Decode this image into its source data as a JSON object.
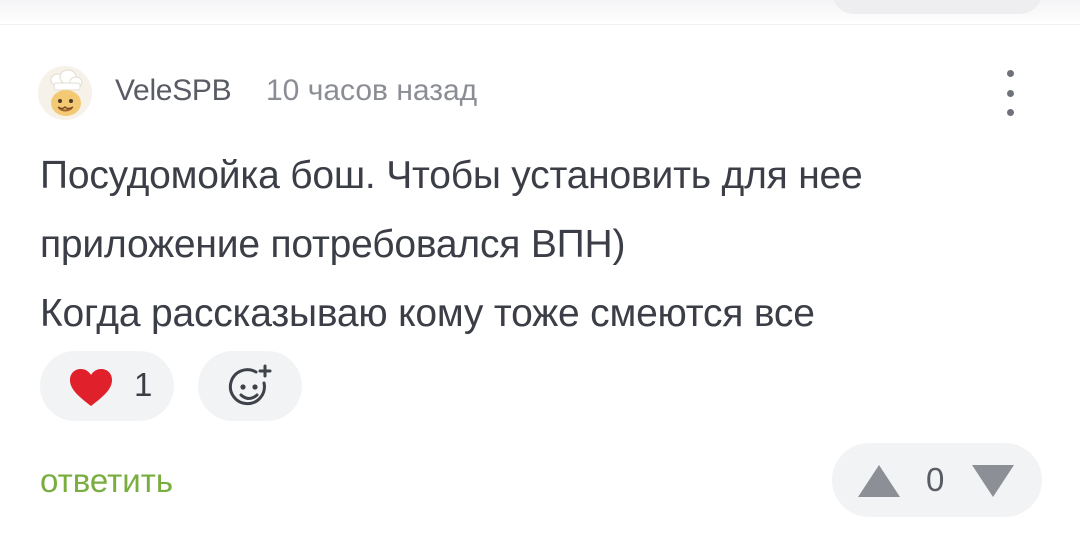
{
  "comment": {
    "author": "VeleSPB",
    "timestamp": "10 часов назад",
    "body_lines": [
      "Посудомойка бош. Чтобы установить для нее",
      "приложение потребовался ВПН)",
      "Когда рассказываю кому тоже смеются все"
    ]
  },
  "reactions": {
    "like_count": "1"
  },
  "actions": {
    "reply_label": "ответить"
  },
  "rating": {
    "score": "0"
  },
  "icons": {
    "avatar": "chef-avatar-icon",
    "more": "more-vertical-icon",
    "like": "heart-icon",
    "add_reaction": "smiley-plus-icon",
    "upvote": "triangle-up-icon",
    "downvote": "triangle-down-icon"
  },
  "colors": {
    "heart": "#e0202b",
    "reply_link": "#79ad40",
    "text": "#3b3e46",
    "muted": "#8a8d93",
    "pill_bg": "#f2f3f5"
  }
}
